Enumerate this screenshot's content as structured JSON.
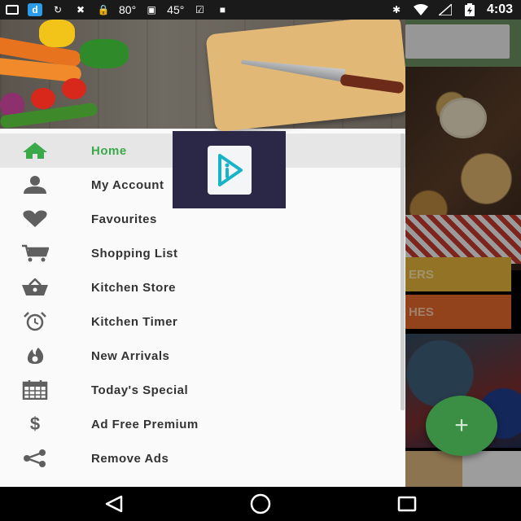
{
  "status_bar": {
    "icons_left": [
      "message-icon",
      "d-app-icon",
      "sync-icon",
      "satellite-off-icon",
      "lock-icon",
      "weather-icon",
      "android-icon",
      "thermometer-icon",
      "check-box-icon",
      "briefcase-icon"
    ],
    "temp_1": "80°",
    "temp_2": "45°",
    "icons_right": [
      "bluetooth-icon",
      "wifi-icon",
      "signal-icon",
      "battery-charging-icon"
    ],
    "time": "4:03"
  },
  "drawer": {
    "menu": [
      {
        "label": "Home",
        "icon": "home-icon",
        "active": true
      },
      {
        "label": "My Account",
        "icon": "person-icon",
        "active": false
      },
      {
        "label": "Favourites",
        "icon": "heart-icon",
        "active": false
      },
      {
        "label": "Shopping List",
        "icon": "cart-icon",
        "active": false
      },
      {
        "label": "Kitchen Store",
        "icon": "basket-icon",
        "active": false
      },
      {
        "label": "Kitchen Timer",
        "icon": "alarm-clock-icon",
        "active": false
      },
      {
        "label": "New Arrivals",
        "icon": "flame-icon",
        "active": false
      },
      {
        "label": "Today's Special",
        "icon": "calendar-icon",
        "active": false
      },
      {
        "label": "Ad Free Premium",
        "icon": "dollar-icon",
        "active": false
      },
      {
        "label": "Remove Ads",
        "icon": "share-icon",
        "active": false
      }
    ]
  },
  "background": {
    "button_1_text": "ERS",
    "button_2_text": "HES",
    "fab_label": "+"
  },
  "colors": {
    "accent": "#3aaa48",
    "popup_bg": "#2b2746",
    "button_yellow": "#e2b23c",
    "button_orange": "#e0682c"
  }
}
